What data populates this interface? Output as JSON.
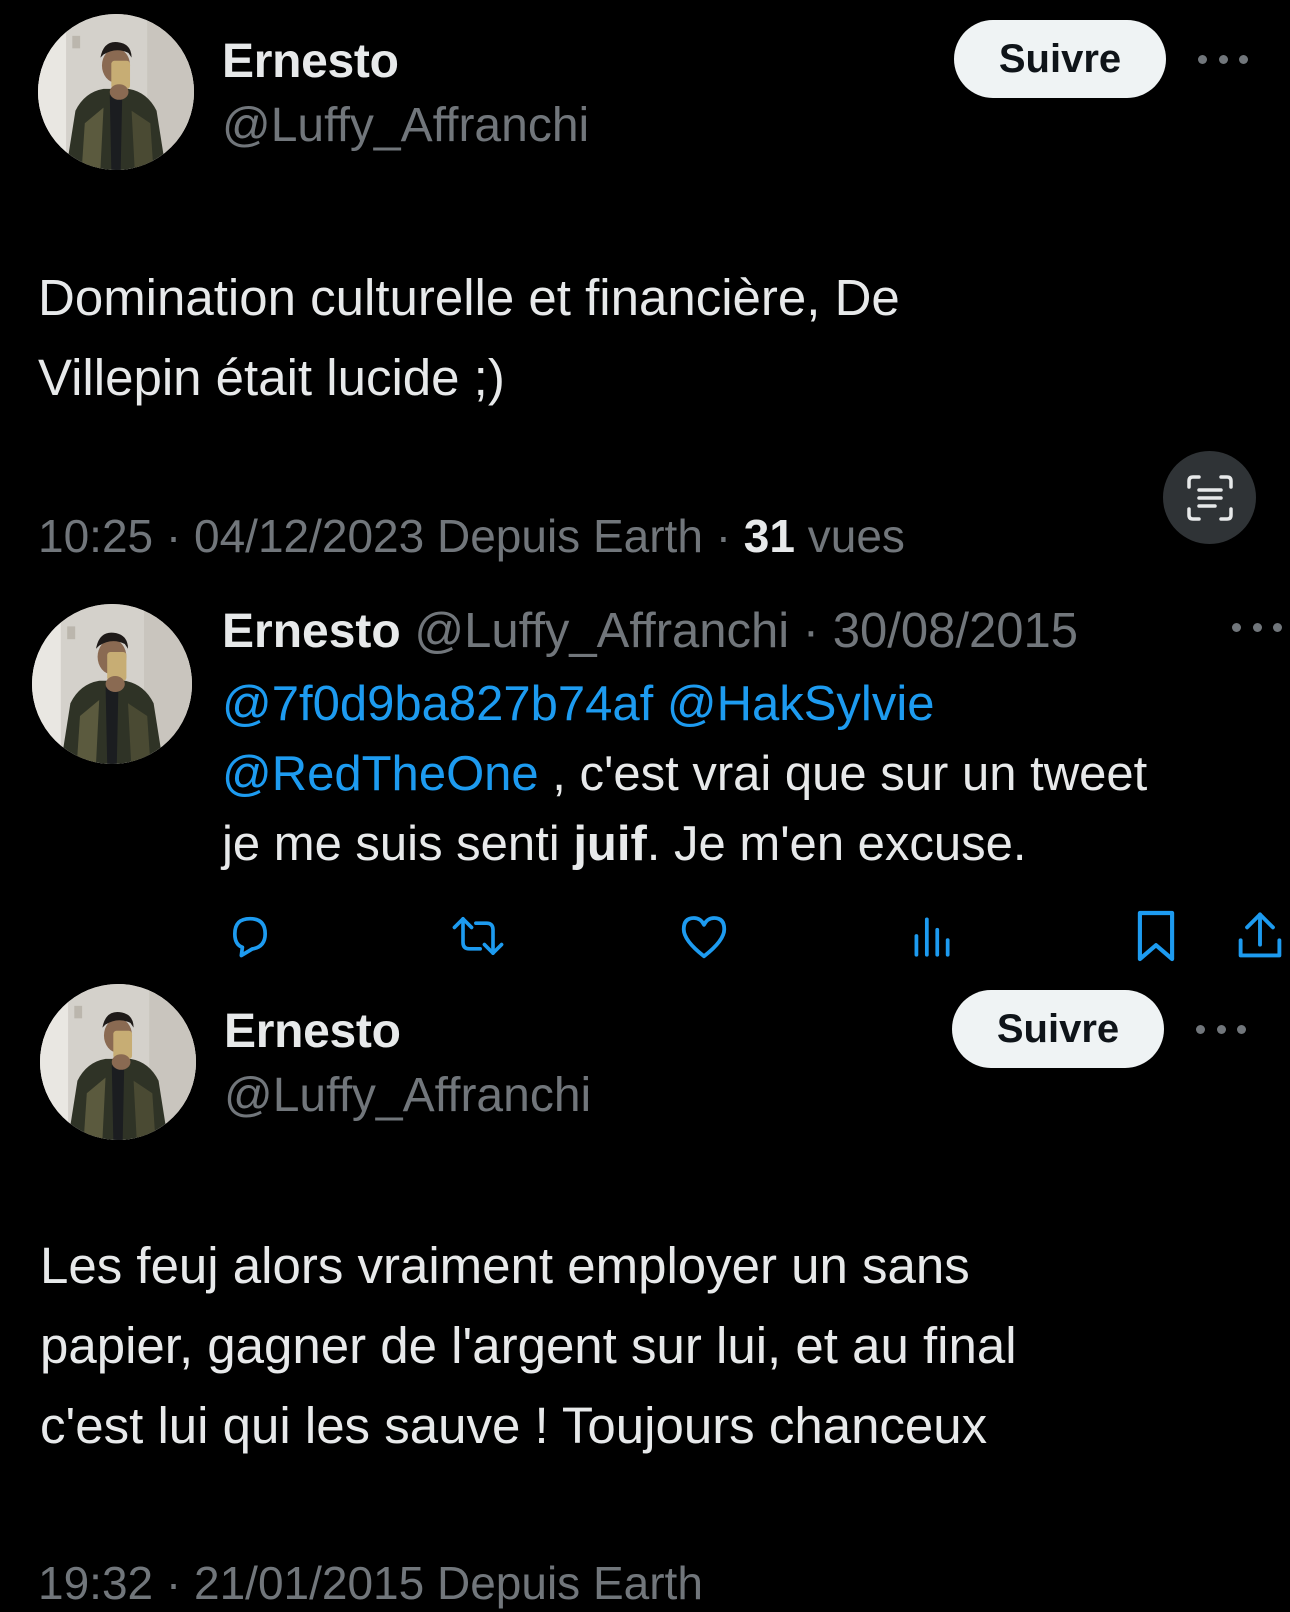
{
  "tweet1": {
    "name": "Ernesto",
    "handle": "@Luffy_Affranchi",
    "follow_label": "Suivre",
    "text_line1": "Domination culturelle et financière, De",
    "text_line2": "Villepin était lucide ;)",
    "time_date": "10:25 · 04/12/2023 Depuis Earth ·",
    "views_count": "31",
    "views_label": "vues"
  },
  "tweet2": {
    "name": "Ernesto",
    "handle_date": "@Luffy_Affranchi · 30/08/2015",
    "mention1": "@7f0d9ba827b74af",
    "mention2": "@HakSylvie",
    "mention3": "@RedTheOne",
    "text_after_mentions": " , c'est vrai que sur un tweet",
    "text_line3_start": "je me suis senti ",
    "text_line3_bold": "juif",
    "text_line3_end": ". Je m'en excuse."
  },
  "tweet3": {
    "name": "Ernesto",
    "handle": "@Luffy_Affranchi",
    "follow_label": "Suivre",
    "text_line1": "Les feuj alors vraiment employer un sans",
    "text_line2": "papier, gagner de l'argent sur lui, et au final",
    "text_line3": "c'est lui qui les sauve ! Toujours chanceux",
    "time_date": "19:32 · 21/01/2015 Depuis Earth"
  },
  "icons": {
    "more": "more-dots-icon",
    "scan": "text-scan-icon",
    "reply": "reply-icon",
    "retweet": "retweet-icon",
    "like": "heart-icon",
    "views": "views-chart-icon",
    "bookmark": "bookmark-icon",
    "share": "share-icon"
  },
  "colors": {
    "background": "#000000",
    "text": "#e7e9ea",
    "muted": "#71767b",
    "mention": "#1d9bf0",
    "button_bg": "#eff3f4"
  }
}
